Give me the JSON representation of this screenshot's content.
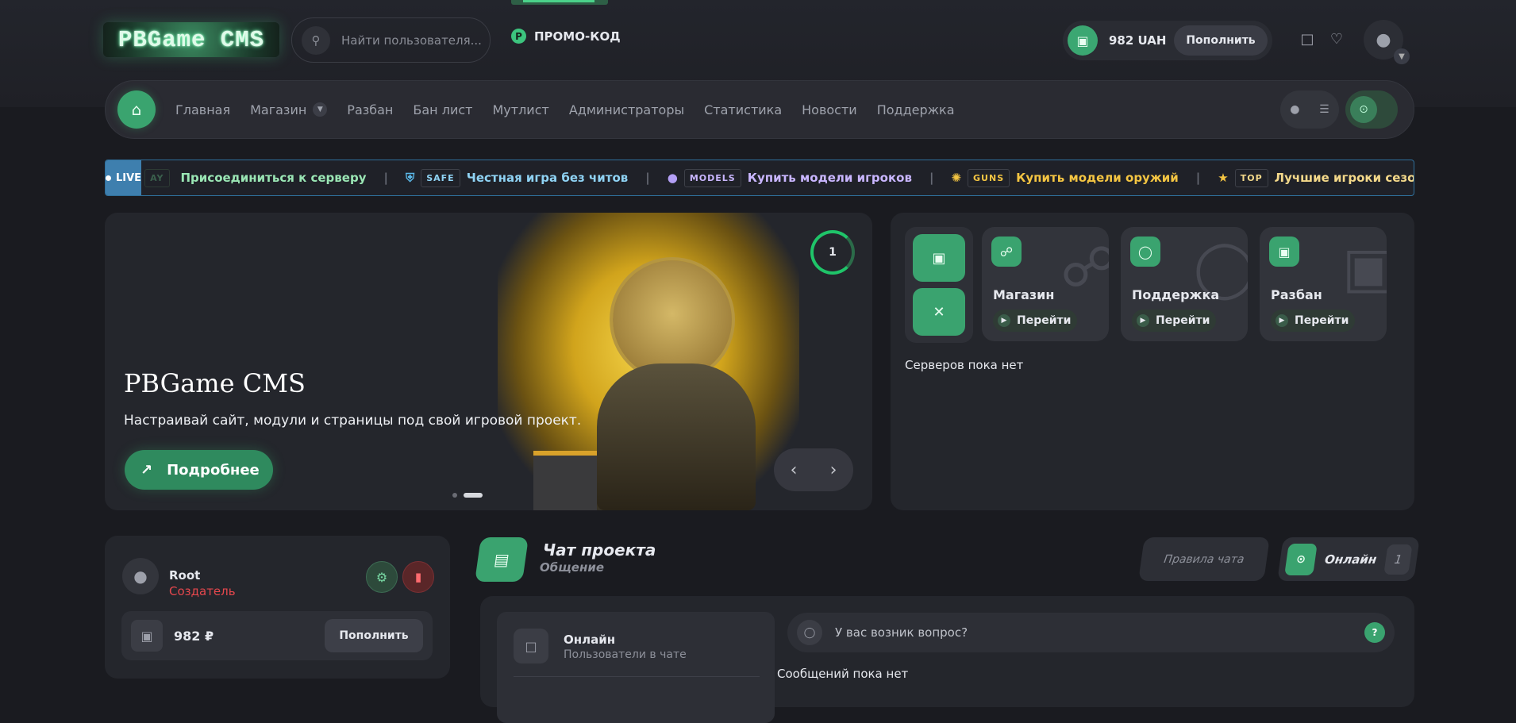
{
  "header": {
    "logo_text": "PBGame CMS",
    "search_placeholder": "Найти пользователя...",
    "promo_icon": "P",
    "promo_label": "ПРОМО-КОД",
    "balance": "982 UAH",
    "topup_label": "Пополнить"
  },
  "nav": {
    "items": [
      "Главная",
      "Магазин",
      "Разбан",
      "Бан лист",
      "Мутлист",
      "Администраторы",
      "Статистика",
      "Новости",
      "Поддержка"
    ]
  },
  "ticker": {
    "live_label": "LIVE",
    "partial_tag": "AY",
    "join_text": "Присоединиться к серверу",
    "items": [
      {
        "tag": "SAFE",
        "text": "Честная игра без читов",
        "color": "#8fd3f4"
      },
      {
        "tag": "MODELS",
        "text": "Купить модели игроков",
        "color": "#c9b6ff"
      },
      {
        "tag": "GUNS",
        "text": "Купить модели оружий",
        "color": "#f4c542"
      },
      {
        "tag": "TOP",
        "text": "Лучшие игроки сезона",
        "color": "#f4d98a"
      }
    ]
  },
  "hero": {
    "title": "PBGame CMS",
    "subtitle": "Настраивай сайт, модули и страницы под свой игровой проект.",
    "button": "Подробнее",
    "counter": "1"
  },
  "side": {
    "cards": [
      {
        "title": "Магазин",
        "button": "Перейти",
        "icon": "cart-icon"
      },
      {
        "title": "Поддержка",
        "button": "Перейти",
        "icon": "headset-icon"
      },
      {
        "title": "Разбан",
        "button": "Перейти",
        "icon": "unlock-icon"
      }
    ],
    "no_servers": "Серверов пока нет"
  },
  "profile": {
    "name": "Root",
    "role": "Создатель",
    "balance": "982 ₽",
    "topup_label": "Пополнить"
  },
  "chat": {
    "title": "Чат проекта",
    "subtitle": "Общение",
    "rules_label": "Правила чата",
    "online_label": "Онлайн",
    "online_count": "1",
    "users_title": "Онлайн",
    "users_subtitle": "Пользователи в чате",
    "question_placeholder": "У вас возник вопрос?",
    "help_icon": "?",
    "no_messages": "Сообщений пока нет"
  },
  "colors": {
    "accent": "#3aa36f",
    "live": "#3e7fae",
    "danger": "#e5474d"
  }
}
